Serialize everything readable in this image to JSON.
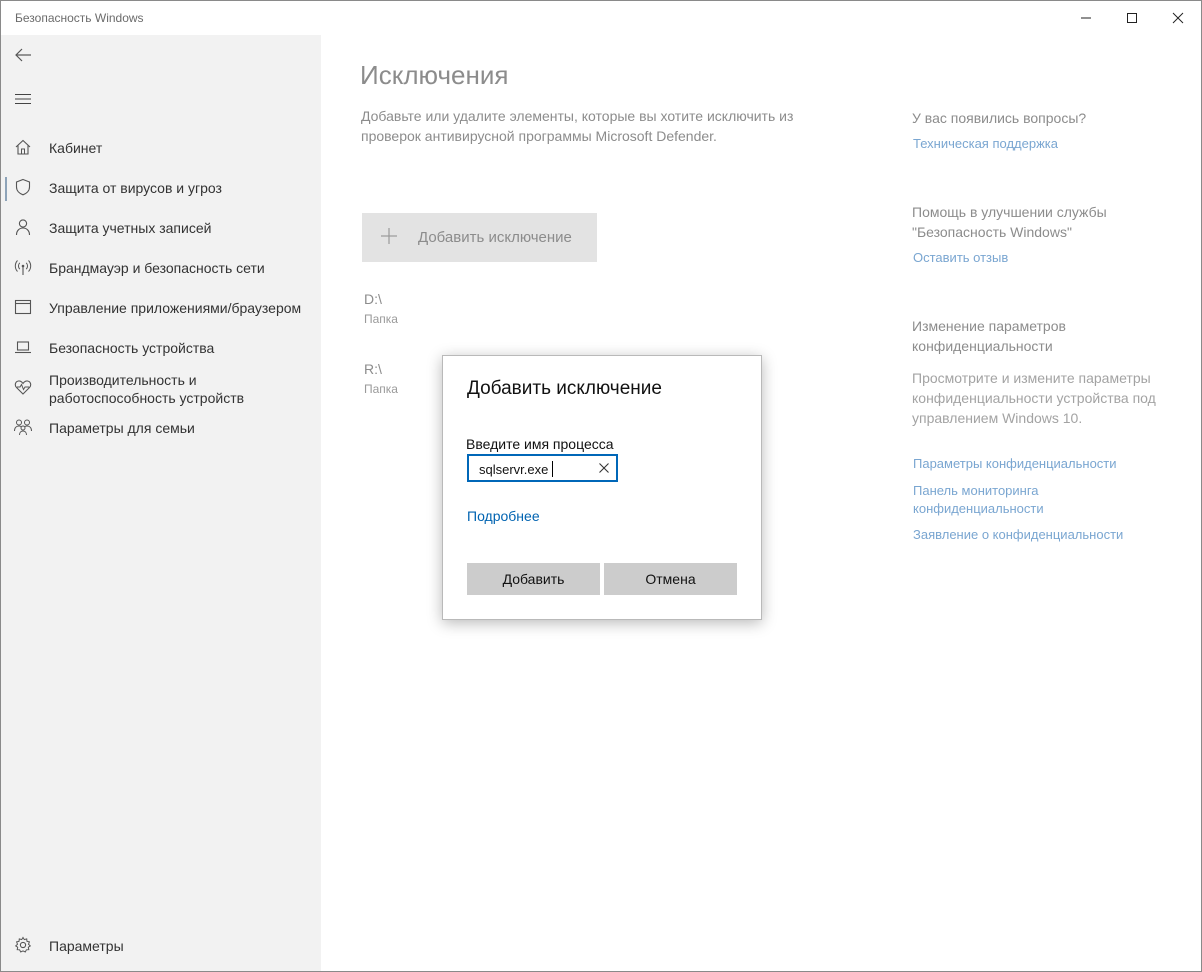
{
  "window": {
    "title": "Безопасность Windows"
  },
  "sidebar": {
    "items": [
      {
        "label": "Кабинет",
        "icon": "home-icon"
      },
      {
        "label": "Защита от вирусов и угроз",
        "icon": "shield-icon",
        "selected": true
      },
      {
        "label": "Защита учетных записей",
        "icon": "person-icon"
      },
      {
        "label": "Брандмауэр и безопасность сети",
        "icon": "wifi-antenna-icon"
      },
      {
        "label": "Управление приложениями/браузером",
        "icon": "app-window-icon"
      },
      {
        "label": "Безопасность устройства",
        "icon": "laptop-icon"
      },
      {
        "label": "Производительность и работоспособность устройств",
        "icon": "heart-pulse-icon"
      },
      {
        "label": "Параметры для семьи",
        "icon": "family-icon"
      }
    ],
    "settings_label": "Параметры"
  },
  "main": {
    "title": "Исключения",
    "description": "Добавьте или удалите элементы, которые вы хотите исключить из проверок антивирусной программы Microsoft Defender.",
    "add_button_label": "Добавить исключение",
    "exclusions": [
      {
        "path": "D:\\",
        "type": "Папка"
      },
      {
        "path": "R:\\",
        "type": "Папка"
      }
    ]
  },
  "right": {
    "questions_heading": "У вас появились вопросы?",
    "support_link": "Техническая поддержка",
    "improve_heading": "Помощь в улучшении службы \"Безопасность Windows\"",
    "feedback_link": "Оставить отзыв",
    "privacy_heading": "Изменение параметров конфиденциальности",
    "privacy_text": "Просмотрите и измените параметры конфиденциальности устройства под управлением Windows 10.",
    "privacy_settings_link": "Параметры конфиденциальности",
    "privacy_dashboard_link": "Панель мониторинга конфиденциальности",
    "privacy_statement_link": "Заявление о конфиденциальности"
  },
  "dialog": {
    "title": "Добавить исключение",
    "input_label": "Введите имя процесса",
    "input_value": "sqlservr.exe",
    "more_link": "Подробнее",
    "ok_label": "Добавить",
    "cancel_label": "Отмена"
  },
  "colors": {
    "accent": "#0067b8",
    "link": "#0063b1",
    "sidebar_bg": "#f2f2f2",
    "button_bg": "#cccccc"
  }
}
